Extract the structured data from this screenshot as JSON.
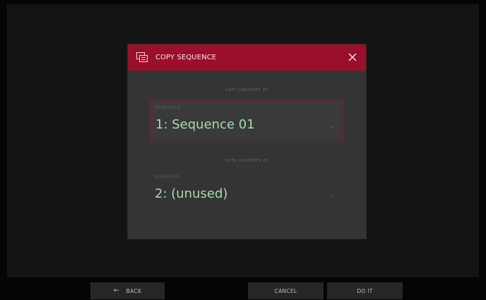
{
  "dialog": {
    "title": "COPY SEQUENCE",
    "header_color": "#9a0f2c",
    "icon": "copy-sequence-icon",
    "close_icon": "close-icon"
  },
  "source": {
    "section_label": "COPY CONTENTS OF",
    "field_label": "SEQUENCE",
    "value": "1: Sequence 01"
  },
  "destination": {
    "section_label": "OVER CONTENTS OF",
    "field_label": "SEQUENCE",
    "value": "2: (unused)"
  },
  "footer": {
    "back_label": "BACK",
    "back_icon": "arrow-left-icon",
    "cancel_label": "CANCEL",
    "do_it_label": "DO IT"
  }
}
